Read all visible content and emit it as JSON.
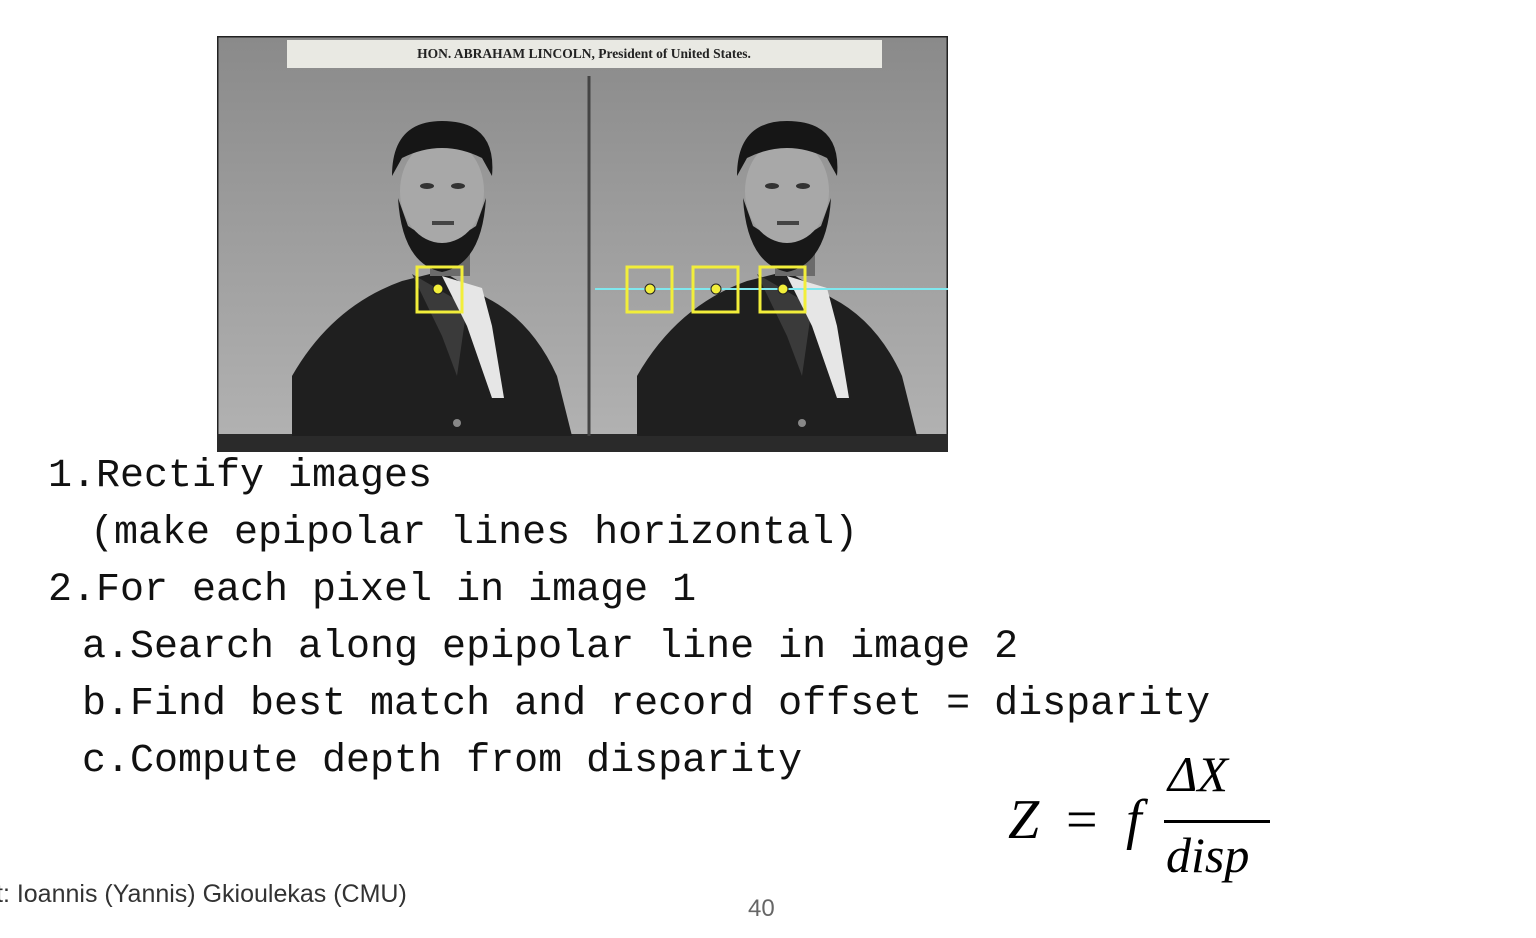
{
  "photo": {
    "caption": "HON. ABRAHAM LINCOLN, President of United States."
  },
  "steps": {
    "s1": "1.Rectify images",
    "s1b": "(make epipolar lines horizontal)",
    "s2": "2.For each pixel in image 1",
    "a": "a.Search along epipolar line in image 2",
    "b": "b.Find best match and record offset = disparity",
    "c": "c.Compute depth from disparity"
  },
  "formula": {
    "lhs": "Z",
    "equals": "=",
    "f": "f",
    "numerator": "ΔX",
    "denominator": "disp"
  },
  "footer": {
    "credit": "t: Ioannis (Yannis) Gkioulekas (CMU)",
    "page": "40"
  },
  "colors": {
    "window_box": "#f2ee3a",
    "epipolar_line": "#7fe8ef"
  }
}
